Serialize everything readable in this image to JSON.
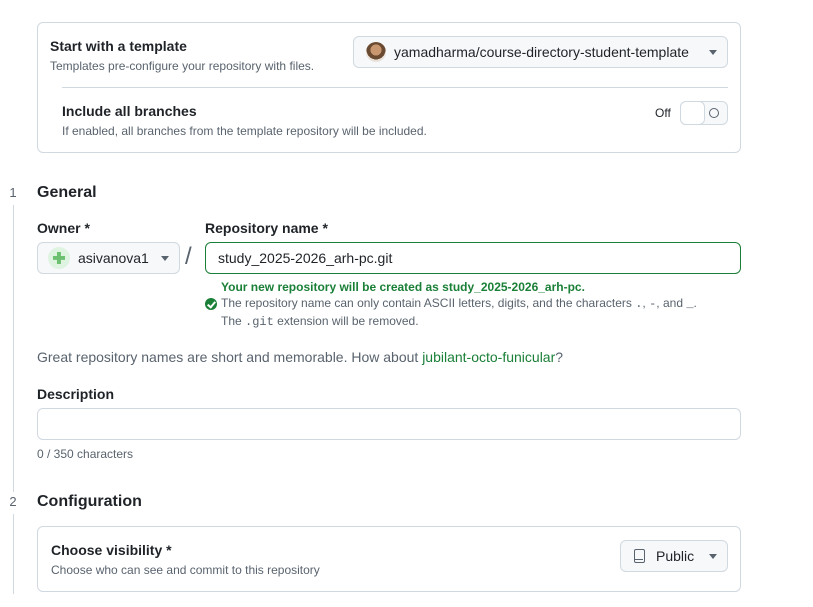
{
  "template": {
    "title": "Start with a template",
    "subtitle": "Templates pre-configure your repository with files.",
    "selected": "yamadharma/course-directory-student-template",
    "branches_title": "Include all branches",
    "branches_subtitle": "If enabled, all branches from the template repository will be included.",
    "toggle_state": "Off"
  },
  "steps": {
    "general": {
      "number": "1",
      "title": "General"
    },
    "configuration": {
      "number": "2",
      "title": "Configuration"
    }
  },
  "owner": {
    "label": "Owner *",
    "value": "asivanova1"
  },
  "separator": "/",
  "repo": {
    "label": "Repository name *",
    "value": "study_2025-2026_arh-pc.git",
    "success": "Your new repository will be created as study_2025-2026_arh-pc.",
    "hint_1_pre": "The repository name can only contain ASCII letters, digits, and the characters ",
    "hint_1_chars_a": ".",
    "hint_1_sep_a": ", ",
    "hint_1_chars_b": "-",
    "hint_1_sep_b": ", and ",
    "hint_1_chars_c": "_",
    "hint_1_end": ".",
    "hint_2_pre": "The ",
    "hint_2_code": ".git",
    "hint_2_post": " extension will be removed."
  },
  "suggestion": {
    "text": "Great repository names are short and memorable. How about ",
    "name": "jubilant-octo-funicular",
    "end": "?"
  },
  "description": {
    "label": "Description",
    "value": "",
    "count": "0 / 350 characters"
  },
  "visibility": {
    "title": "Choose visibility *",
    "subtitle": "Choose who can see and commit to this repository",
    "selected": "Public"
  }
}
